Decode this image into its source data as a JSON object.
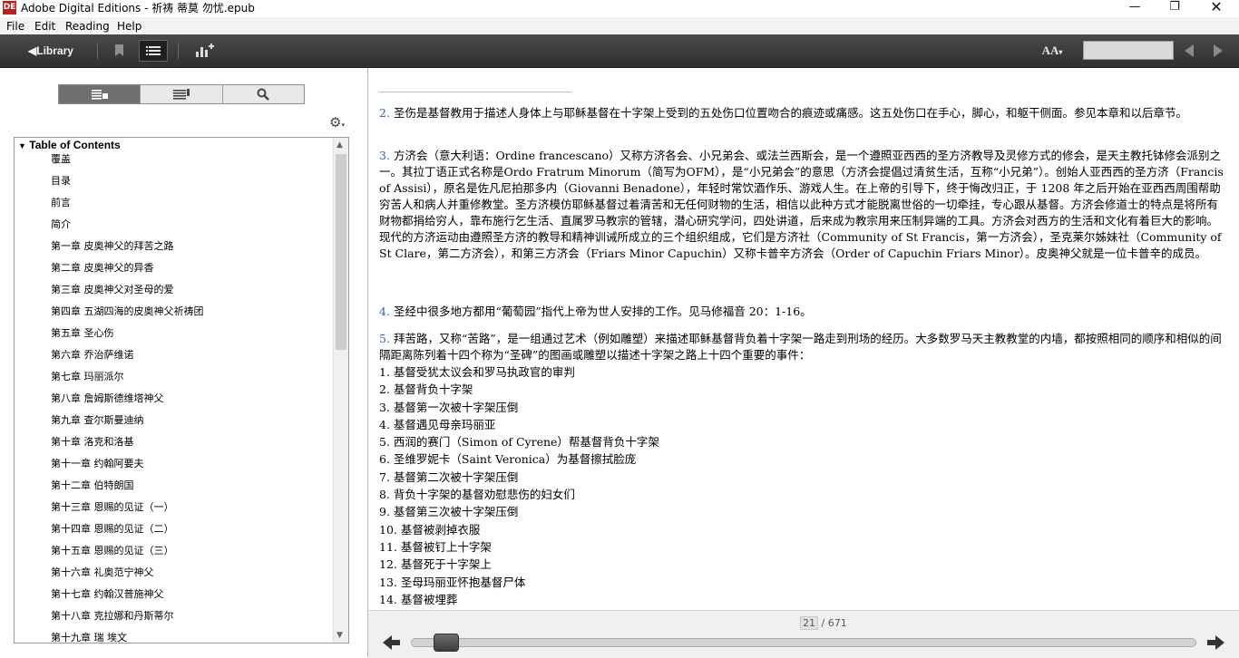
{
  "window": {
    "title": "Adobe Digital Editions - 祈祷 蒂莫 勿忧.epub",
    "app_icon": "adobe-de-icon"
  },
  "menu": [
    "File",
    "Edit",
    "Reading",
    "Help"
  ],
  "toolbar": {
    "library_label": "Library",
    "font_label": "AA",
    "page_input": ""
  },
  "sidebar": {
    "toc_title": "Table of Contents",
    "items": [
      "覆盖",
      "目录",
      "前言",
      "简介",
      "第一章 皮奥神父的拜苦之路",
      "第二章 皮奥神父的异香",
      "第三章 皮奥神父对圣母的爱",
      "第四章 五湖四海的皮奥神父祈祷团",
      "第五章 圣心伤",
      "第六章 乔治萨维诺",
      "第七章 玛丽派尔",
      "第八章 詹姆斯德维塔神父",
      "第九章 查尔斯曼迪纳",
      "第十章 洛克和洛基",
      "第十一章 约翰阿要夫",
      "第十二章 伯特朗国",
      "第十三章 恩赐的见证（一）",
      "第十四章 恩赐的见证（二）",
      "第十五章 恩赐的见证（三）",
      "第十六章 礼奥范宁神父",
      "第十七章 约翰汉普施神父",
      "第十八章 克拉娜和丹斯蒂尔",
      "第十九章 瑞 埃文"
    ]
  },
  "content": {
    "footnotes": [
      {
        "num": "2.",
        "text": "圣伤是基督教用于描述人身体上与耶稣基督在十字架上受到的五处伤口位置吻合的痕迹或痛感。这五处伤口在手心，脚心，和躯干侧面。参见本章和以后章节。"
      },
      {
        "num": "3.",
        "text": "方济会（意大利语：Ordine francescano）又称方济各会、小兄弟会、或法兰西斯会，是一个遵照亚西西的圣方济教导及灵修方式的修会，是天主教托钵修会派别之一。其拉丁语正式名称是Ordo Fratrum Minorum（简写为OFM），是“小兄弟会”的意思（方济会提倡过清贫生活，互称“小兄弟”）。创始人亚西西的圣方济（Francis of Assisi），原名是佐凡尼拍那多内（Giovanni Benadone），年轻时常饮酒作乐、游戏人生。在上帝的引导下，终于悔改归正，于 1208 年之后开始在亚西西周围帮助穷苦人和病人并重修教堂。圣方济模仿耶稣基督过着清苦和无任何财物的生活，相信以此种方式才能脱离世俗的一切牵挂，专心跟从基督。方济会修道士的特点是将所有财物都捐给穷人，靠布施行乞生活、直属罗马教宗的管辖，潜心研究学问，四处讲道，后来成为教宗用来压制异端的工具。方济会对西方的生活和文化有着巨大的影响。现代的方济运动由遵照圣方济的教导和精神训诫所成立的三个组织组成，它们是方济社（Community of St Francis，第一方济会），圣克莱尔姊妹社（Community of St Clare，第二方济会），和第三方济会（Friars Minor Capuchin）又称卡普辛方济会（Order of Capuchin Friars Minor）。皮奥神父就是一位卡普辛的成员。"
      },
      {
        "num": "4.",
        "text": "圣经中很多地方都用“葡萄园”指代上帝为世人安排的工作。见马修福音 20：1-16。"
      },
      {
        "num": "5.",
        "text": "拜苦路，又称“苦路”，是一组通过艺术（例如雕塑）来描述耶稣基督背负着十字架一路走到刑场的经历。大多数罗马天主教教堂的内墙，都按照相同的顺序和相似的间隔距离陈列着十四个称为“圣碑”的图画或雕塑以描述十字架之路上十四个重要的事件："
      }
    ],
    "steps": [
      "1.  基督受犹太议会和罗马执政官的审判",
      "2.  基督背负十字架",
      "3.  基督第一次被十字架压倒",
      "4.  基督遇见母亲玛丽亚",
      "5.  西润的赛门（Simon of Cyrene）帮基督背负十字架",
      "6.  圣维罗妮卡（Saint Veronica）为基督擦拭脸庞",
      "7.  基督第二次被十字架压倒",
      "8.  背负十字架的基督劝慰悲伤的妇女们",
      "9.  基督第三次被十字架压倒",
      "10.  基督被剥掉衣服",
      "11.  基督被钉上十字架",
      "12.  基督死于十字架上",
      "13.  圣母玛丽亚怀抱基督尸体",
      "14.  基督被埋葬"
    ]
  },
  "footer": {
    "current_page": "21",
    "total_pages": "/ 671",
    "progress_fraction": 0.03
  }
}
